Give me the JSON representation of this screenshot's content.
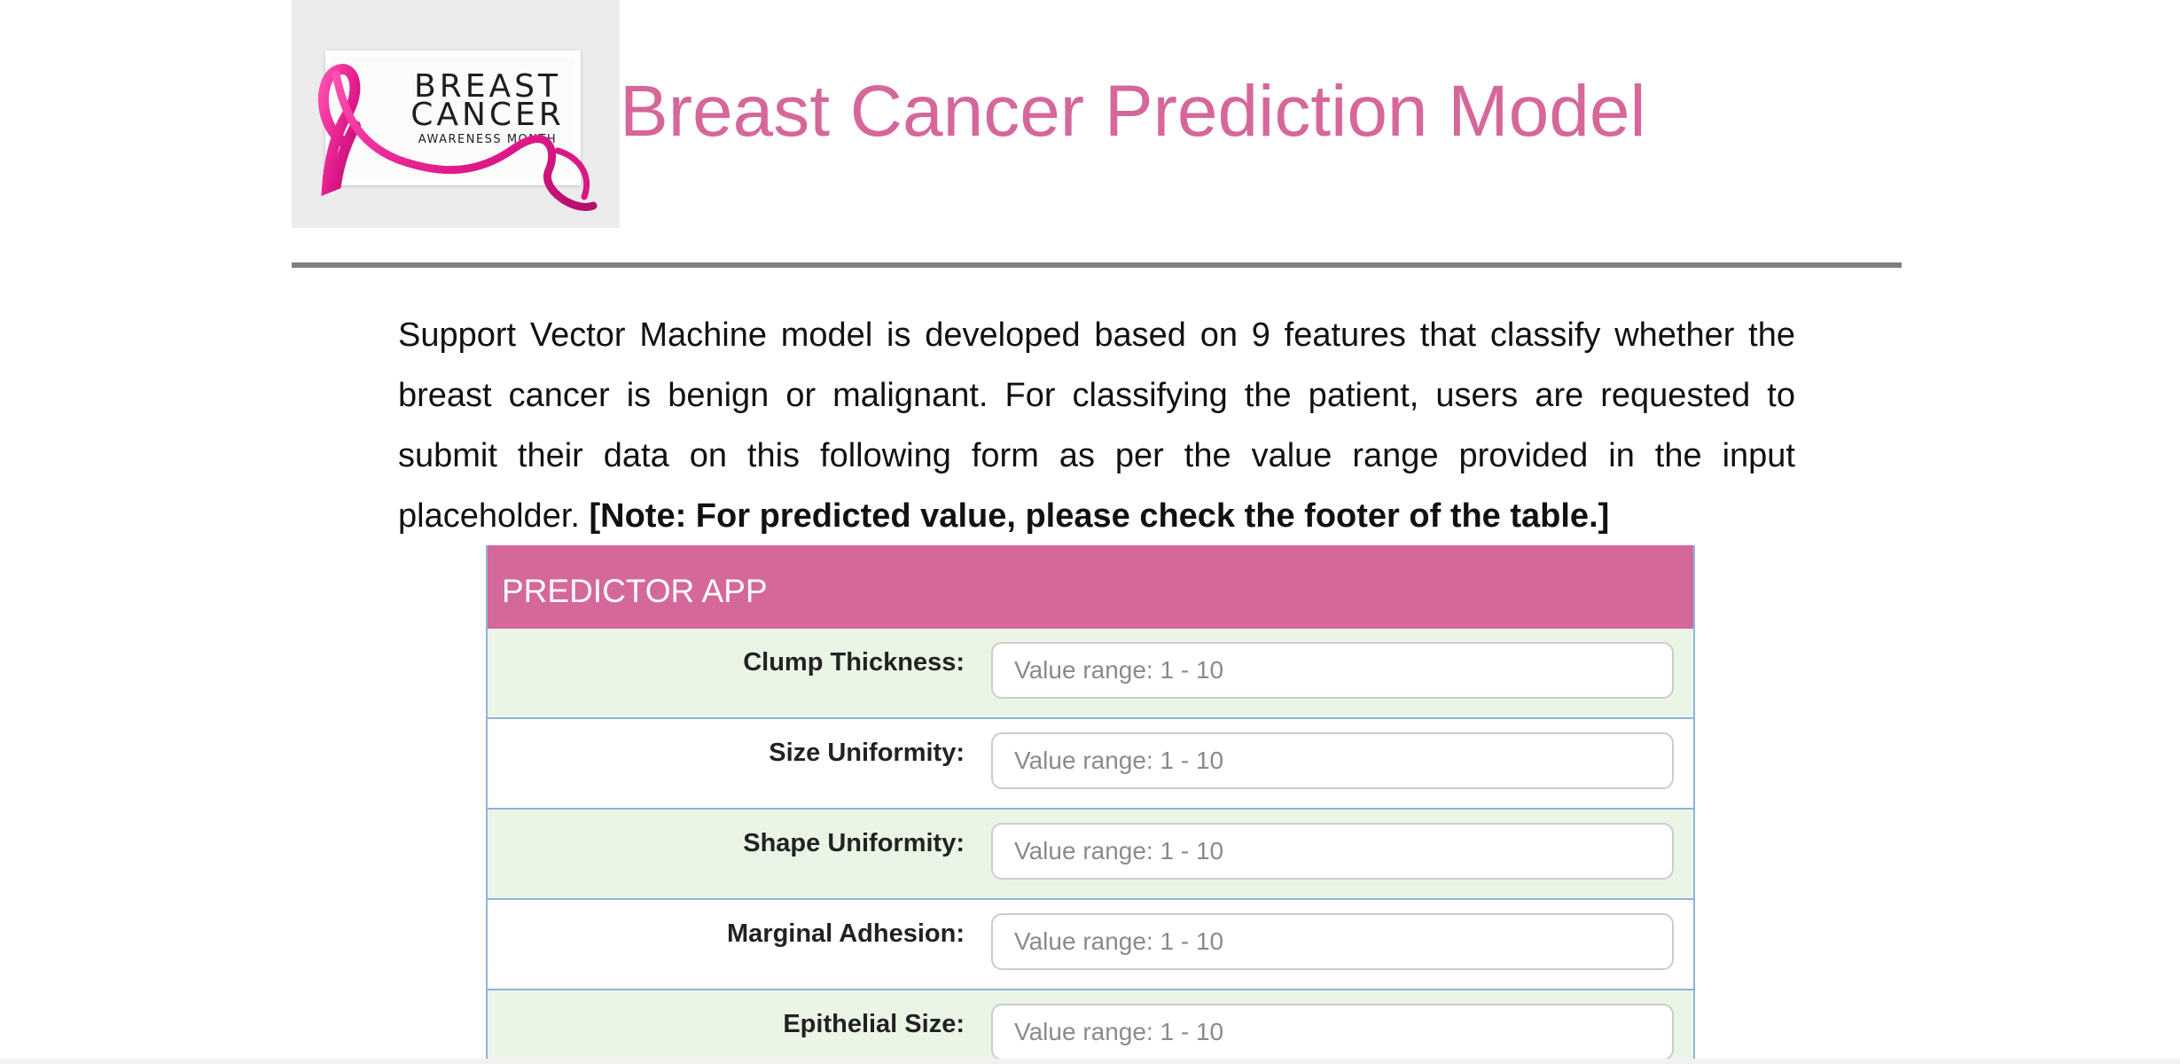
{
  "logo": {
    "line1": "BREAST",
    "line2": "CANCER",
    "line3": "AWARENESS MONTH"
  },
  "header": {
    "title": "Breast Cancer Prediction Model"
  },
  "intro": {
    "text": "Support Vector Machine model is developed based on 9 features that classify whether the breast cancer is benign or malignant. For classifying the patient, users are requested to submit their data on this following form as per the value range provided in the input placeholder. ",
    "note": "[Note: For predicted value, please check the footer of the table.]"
  },
  "app": {
    "header": "PREDICTOR APP",
    "fields": [
      {
        "label": "Clump Thickness:",
        "placeholder": "Value range: 1 - 10",
        "value": ""
      },
      {
        "label": "Size Uniformity:",
        "placeholder": "Value range: 1 - 10",
        "value": ""
      },
      {
        "label": "Shape Uniformity:",
        "placeholder": "Value range: 1 - 10",
        "value": ""
      },
      {
        "label": "Marginal Adhesion:",
        "placeholder": "Value range: 1 - 10",
        "value": ""
      },
      {
        "label": "Epithelial Size:",
        "placeholder": "Value range: 1 - 10",
        "value": ""
      }
    ]
  },
  "colors": {
    "title": "#d5679a",
    "app_header_bg": "#d5689a",
    "row_alt_bg": "#ebf5e6",
    "row_border": "#8fb4dd",
    "ribbon": "#e0198a"
  }
}
